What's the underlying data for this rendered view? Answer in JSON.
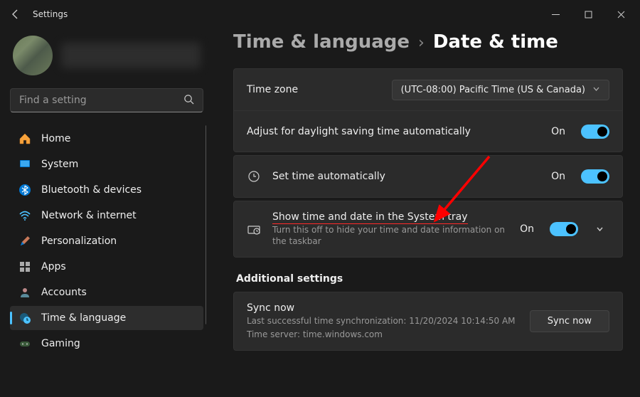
{
  "titlebar": {
    "app_name": "Settings"
  },
  "search": {
    "placeholder": "Find a setting"
  },
  "sidebar": {
    "items": [
      {
        "label": "Home"
      },
      {
        "label": "System"
      },
      {
        "label": "Bluetooth & devices"
      },
      {
        "label": "Network & internet"
      },
      {
        "label": "Personalization"
      },
      {
        "label": "Apps"
      },
      {
        "label": "Accounts"
      },
      {
        "label": "Time & language"
      },
      {
        "label": "Gaming"
      }
    ]
  },
  "breadcrumb": {
    "parent": "Time & language",
    "sep": "›",
    "current": "Date & time"
  },
  "rows": {
    "timezone": {
      "label": "Time zone",
      "value": "(UTC-08:00) Pacific Time (US & Canada)"
    },
    "dst": {
      "label": "Adjust for daylight saving time automatically",
      "state": "On"
    },
    "auto": {
      "label": "Set time automatically",
      "state": "On"
    },
    "systray": {
      "label": "Show time and date in the System tray",
      "sub": "Turn this off to hide your time and date information on the taskbar",
      "state": "On"
    }
  },
  "additional": {
    "header": "Additional settings",
    "sync": {
      "title": "Sync now",
      "line1": "Last successful time synchronization: 11/20/2024 10:14:50 AM",
      "line2": "Time server: time.windows.com",
      "button": "Sync now"
    }
  }
}
